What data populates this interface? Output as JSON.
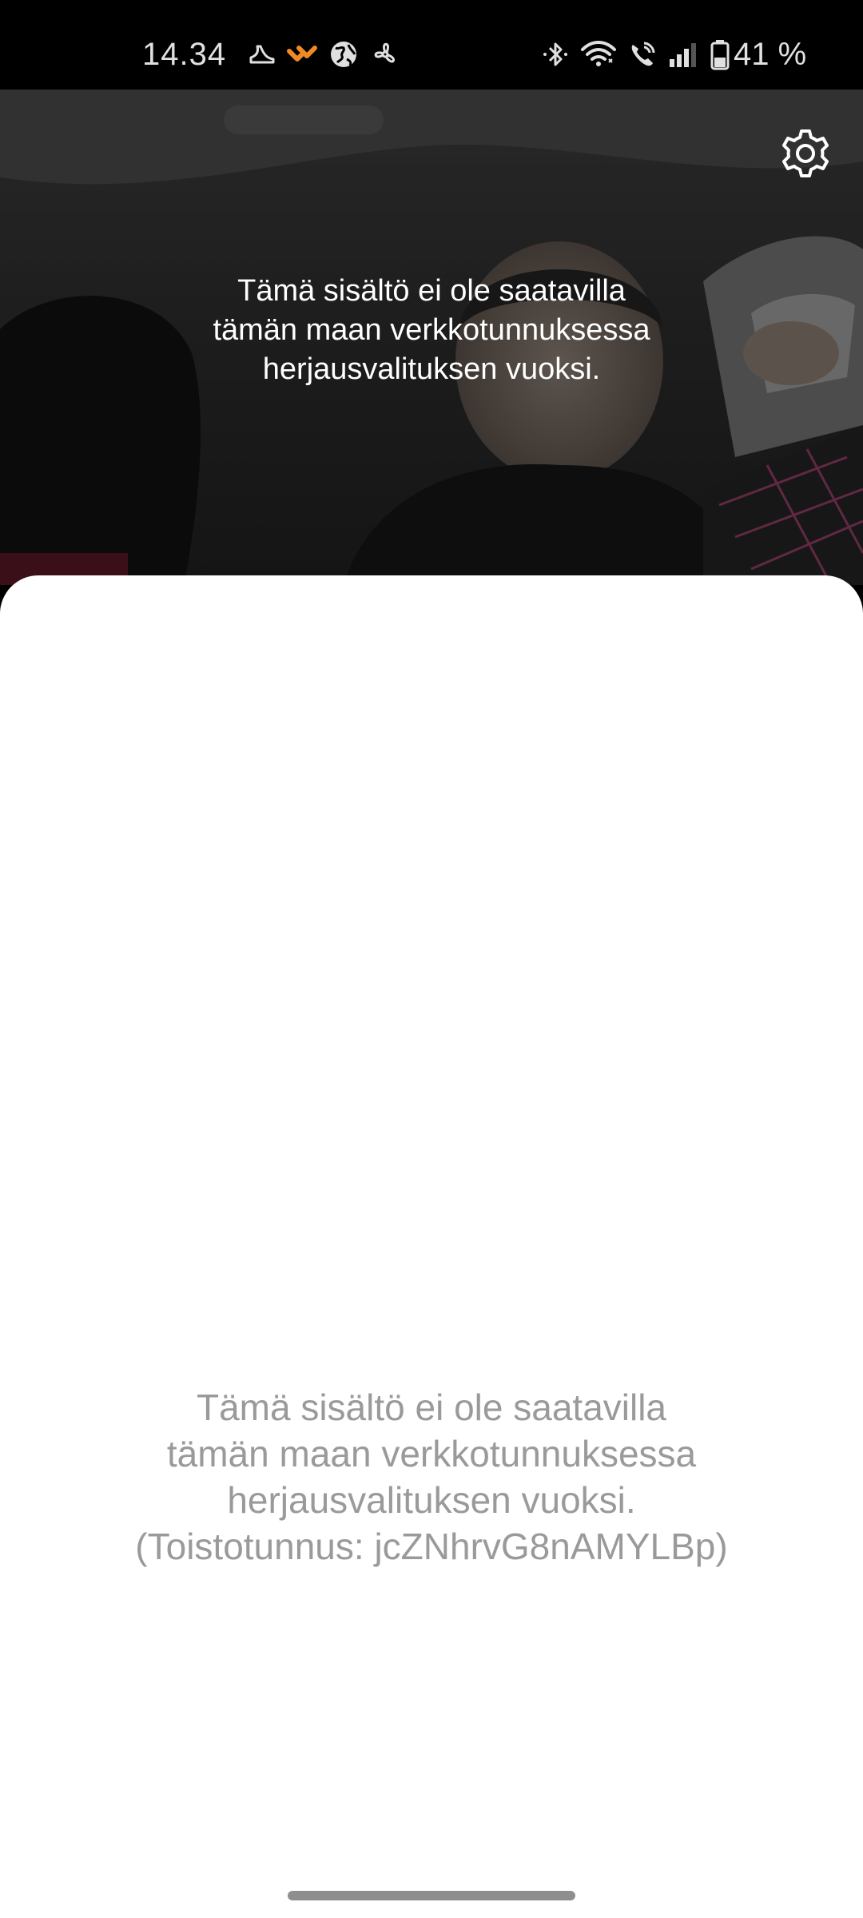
{
  "status_bar": {
    "time": "14.34",
    "battery_percent": "41 %",
    "notification_icons": [
      "shoe-icon",
      "orange-app-icon",
      "globe-icon",
      "fan-icon"
    ],
    "system_icons": [
      "bluetooth-icon",
      "wifi-icon",
      "wifi-calling-icon",
      "signal-icon",
      "battery-icon"
    ],
    "battery_level": 0.41
  },
  "video": {
    "message_lines": [
      "Tämä sisältö ei ole saatavilla",
      "tämän maan verkkotunnuksessa",
      "herjausvalituksen vuoksi."
    ],
    "settings_icon": "gear-icon"
  },
  "sheet": {
    "message_lines": [
      "Tämä sisältö ei ole saatavilla",
      "tämän maan verkkotunnuksessa",
      "herjausvalituksen vuoksi.",
      "(Toistotunnus: jcZNhrvG8nAMYLBp)"
    ]
  },
  "colors": {
    "status_bar_bg": "#000000",
    "sheet_bg": "#ffffff",
    "sheet_text": "#9a9a9a",
    "accent_orange": "#f08a24"
  }
}
